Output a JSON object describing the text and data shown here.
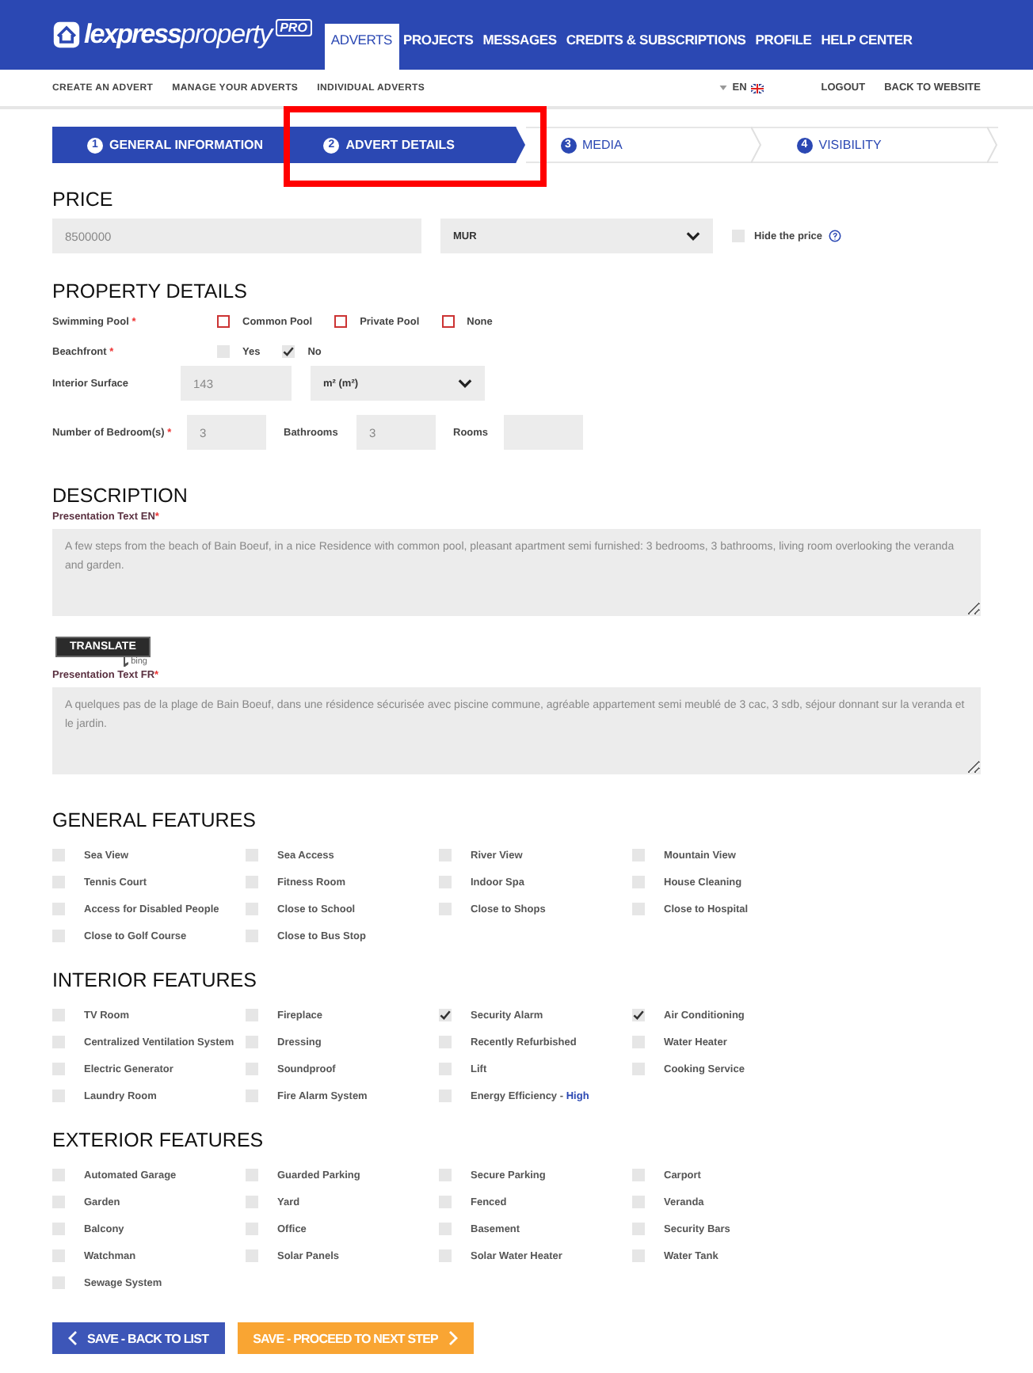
{
  "logo": {
    "bold": "lexpress",
    "light": "property",
    "badge": "PRO"
  },
  "nav": [
    {
      "label": "ADVERTS",
      "selected": true
    },
    {
      "label": "PROJECTS",
      "selected": false
    },
    {
      "label": "MESSAGES",
      "selected": false
    },
    {
      "label": "CREDITS & SUBSCRIPTIONS",
      "selected": false
    },
    {
      "label": "PROFILE",
      "selected": false
    },
    {
      "label": "HELP CENTER",
      "selected": false
    }
  ],
  "subnav": [
    "CREATE AN ADVERT",
    "MANAGE YOUR ADVERTS",
    "INDIVIDUAL ADVERTS"
  ],
  "language": "EN",
  "account_links": [
    "LOGOUT",
    "BACK TO WEBSITE"
  ],
  "steps": [
    {
      "number": "1",
      "label": "GENERAL INFORMATION",
      "completed": true,
      "selected": false,
      "highlighted": false
    },
    {
      "number": "2",
      "label": "ADVERT DETAILS",
      "selected": true,
      "highlighted": true
    },
    {
      "number": "3",
      "label": "MEDIA",
      "completed": false,
      "selected": false,
      "highlighted": false
    },
    {
      "number": "4",
      "label": "VISIBILITY",
      "completed": false,
      "selected": false,
      "highlighted": false
    }
  ],
  "price": {
    "title": "PRICE",
    "value": "8500000",
    "currency": "MUR",
    "hide_label": "Hide the price",
    "hide_checked": false
  },
  "property_details": {
    "title": "PROPERTY DETAILS",
    "swimming_pool": {
      "label": "Swimming Pool",
      "required_mark": "*",
      "invalid": true,
      "options": [
        {
          "label": "Common Pool",
          "checked": false
        },
        {
          "label": "Private Pool",
          "checked": false
        },
        {
          "label": "None",
          "checked": false
        }
      ]
    },
    "beachfront": {
      "label": "Beachfront",
      "required_mark": "*",
      "invalid": false,
      "options": [
        {
          "label": "Yes",
          "checked": false
        },
        {
          "label": "No",
          "checked": true
        }
      ]
    },
    "interior_surface": {
      "label": "Interior Surface",
      "value": "143",
      "unit": "m² (m²)"
    },
    "bedrooms": {
      "label": "Number of Bedroom(s)",
      "required_mark": "*",
      "value": "3"
    },
    "bathrooms": {
      "label": "Bathrooms",
      "value": "3"
    },
    "rooms": {
      "label": "Rooms"
    }
  },
  "description": {
    "title": "DESCRIPTION",
    "texts": [
      {
        "label": "Presentation Text EN",
        "required_mark": "*",
        "value": "A few steps from the beach of Bain Boeuf, in a nice Residence with common pool, pleasant apartment semi furnished: 3 bedrooms, 3 bathrooms, living room overlooking the veranda and garden.",
        "translate": "TRANSLATE",
        "provider": "bing"
      },
      {
        "label": "Presentation Text FR",
        "required_mark": "*",
        "value": "A quelques pas de la plage de Bain Boeuf, dans une résidence sécurisée avec piscine commune, agréable appartement semi meublé de 3 cac, 3 sdb, séjour donnant sur la veranda et le jardin."
      }
    ]
  },
  "feature_sections": [
    {
      "title": "GENERAL FEATURES",
      "items": [
        {
          "label": "Sea View",
          "checked": false
        },
        {
          "label": "Sea Access",
          "checked": false
        },
        {
          "label": "River View",
          "checked": false
        },
        {
          "label": "Mountain View",
          "checked": false
        },
        {
          "label": "Tennis Court",
          "checked": false
        },
        {
          "label": "Fitness Room",
          "checked": false
        },
        {
          "label": "Indoor Spa",
          "checked": false
        },
        {
          "label": "House Cleaning",
          "checked": false
        },
        {
          "label": "Access for Disabled People",
          "checked": false
        },
        {
          "label": "Close to School",
          "checked": false
        },
        {
          "label": "Close to Shops",
          "checked": false
        },
        {
          "label": "Close to Hospital",
          "checked": false
        },
        {
          "label": "Close to Golf Course",
          "checked": false
        },
        {
          "label": "Close to Bus Stop",
          "checked": false
        }
      ]
    },
    {
      "title": "INTERIOR FEATURES",
      "items": [
        {
          "label": "TV Room",
          "checked": false
        },
        {
          "label": "Fireplace",
          "checked": false
        },
        {
          "label": "Security Alarm",
          "checked": true
        },
        {
          "label": "Air Conditioning",
          "checked": true
        },
        {
          "label": "Centralized Ventilation System",
          "checked": false
        },
        {
          "label": "Dressing",
          "checked": false
        },
        {
          "label": "Recently Refurbished",
          "checked": false
        },
        {
          "label": "Water Heater",
          "checked": false
        },
        {
          "label": "Electric Generator",
          "checked": false
        },
        {
          "label": "Soundproof",
          "checked": false
        },
        {
          "label": "Lift",
          "checked": false
        },
        {
          "label": "Cooking Service",
          "checked": false
        },
        {
          "label": "Laundry Room",
          "checked": false
        },
        {
          "label": "Fire Alarm System",
          "checked": false
        },
        {
          "label": "Energy Efficiency -",
          "value": "High",
          "checked": false
        }
      ]
    },
    {
      "title": "EXTERIOR FEATURES",
      "items": [
        {
          "label": "Automated Garage",
          "checked": false
        },
        {
          "label": "Guarded Parking",
          "checked": false
        },
        {
          "label": "Secure Parking",
          "checked": false
        },
        {
          "label": "Carport",
          "checked": false
        },
        {
          "label": "Garden",
          "checked": false
        },
        {
          "label": "Yard",
          "checked": false
        },
        {
          "label": "Fenced",
          "checked": false
        },
        {
          "label": "Veranda",
          "checked": false
        },
        {
          "label": "Balcony",
          "checked": false
        },
        {
          "label": "Office",
          "checked": false
        },
        {
          "label": "Basement",
          "checked": false
        },
        {
          "label": "Security Bars",
          "checked": false
        },
        {
          "label": "Watchman",
          "checked": false
        },
        {
          "label": "Solar Panels",
          "checked": false
        },
        {
          "label": "Solar Water Heater",
          "checked": false
        },
        {
          "label": "Water Tank",
          "checked": false
        },
        {
          "label": "Sewage System",
          "checked": false
        }
      ]
    }
  ],
  "actions": [
    {
      "kind": "back",
      "label": "SAVE - BACK TO LIST"
    },
    {
      "kind": "next",
      "label": "SAVE - PROCEED TO NEXT STEP"
    }
  ]
}
